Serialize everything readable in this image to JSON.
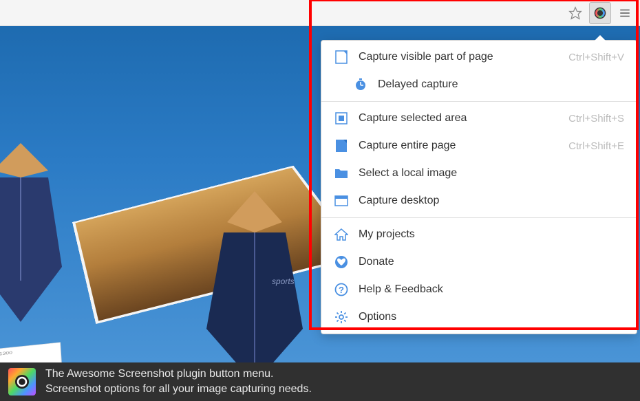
{
  "menu": {
    "section1": [
      {
        "label": "Capture visible part of page",
        "shortcut": "Ctrl+Shift+V",
        "icon": "page-icon"
      },
      {
        "label": "Delayed capture",
        "shortcut": "",
        "icon": "timer-icon",
        "sub": true
      }
    ],
    "section2": [
      {
        "label": "Capture selected area",
        "shortcut": "Ctrl+Shift+S",
        "icon": "selection-icon"
      },
      {
        "label": "Capture entire page",
        "shortcut": "Ctrl+Shift+E",
        "icon": "page-icon"
      },
      {
        "label": "Select a local image",
        "shortcut": "",
        "icon": "folder-icon"
      },
      {
        "label": "Capture desktop",
        "shortcut": "",
        "icon": "desktop-icon"
      }
    ],
    "section3": [
      {
        "label": "My projects",
        "shortcut": "",
        "icon": "home-icon"
      },
      {
        "label": "Donate",
        "shortcut": "",
        "icon": "heart-icon"
      },
      {
        "label": "Help & Feedback",
        "shortcut": "",
        "icon": "help-icon"
      },
      {
        "label": "Options",
        "shortcut": "",
        "icon": "gear-icon"
      }
    ]
  },
  "caption": {
    "line1": "The Awesome Screenshot plugin button menu.",
    "line2": "Screenshot options for all your image capturing needs."
  },
  "colors": {
    "highlight": "#ff0000",
    "icon_blue": "#4a90e2"
  }
}
